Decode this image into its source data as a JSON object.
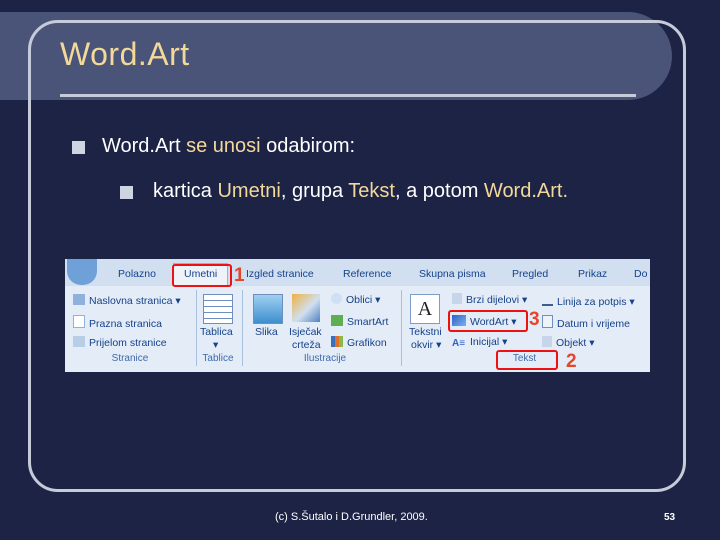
{
  "slide": {
    "title": "Word.Art",
    "line1": {
      "a": "Word.Art ",
      "b": "se unosi",
      "c": " odabirom:"
    },
    "line2": {
      "a": "kartica ",
      "b": "Umetni",
      "c": ", grupa ",
      "d": "Tekst",
      "e": ", a potom ",
      "f": "Word.Art."
    },
    "footer": "(c) S.Šutalo i D.Grundler, 2009.",
    "page_number": "53"
  },
  "ribbon": {
    "tabs": [
      "Polazno",
      "Umetni",
      "Izgled stranice",
      "Reference",
      "Skupna pisma",
      "Pregled",
      "Prikaz",
      "Do"
    ],
    "pages_items": [
      "Naslovna stranica",
      "Prazna stranica",
      "Prijelom stranice"
    ],
    "group_labels": [
      "Stranice",
      "Tablice",
      "Ilustracije",
      "Tekst"
    ],
    "table_label": "Tablica",
    "illustrations": {
      "picture": "Slika",
      "clip1": "Isječak",
      "clip2": "crteža",
      "shapes": "Oblici",
      "smartart": "SmartArt",
      "chart": "Grafikon"
    },
    "text": {
      "textbox1": "Tekstni",
      "textbox2": "okvir",
      "quickparts": "Brzi dijelovi",
      "wordart": "WordArt",
      "dropcap": "Inicijal",
      "signature": "Linija za potpis",
      "datetime": "Datum i vrijeme",
      "object": "Objekt"
    },
    "markers": [
      "1",
      "2",
      "3"
    ]
  },
  "colors": {
    "background": "#1d2345",
    "accent": "#f2d99a",
    "marker": "#e11111"
  }
}
